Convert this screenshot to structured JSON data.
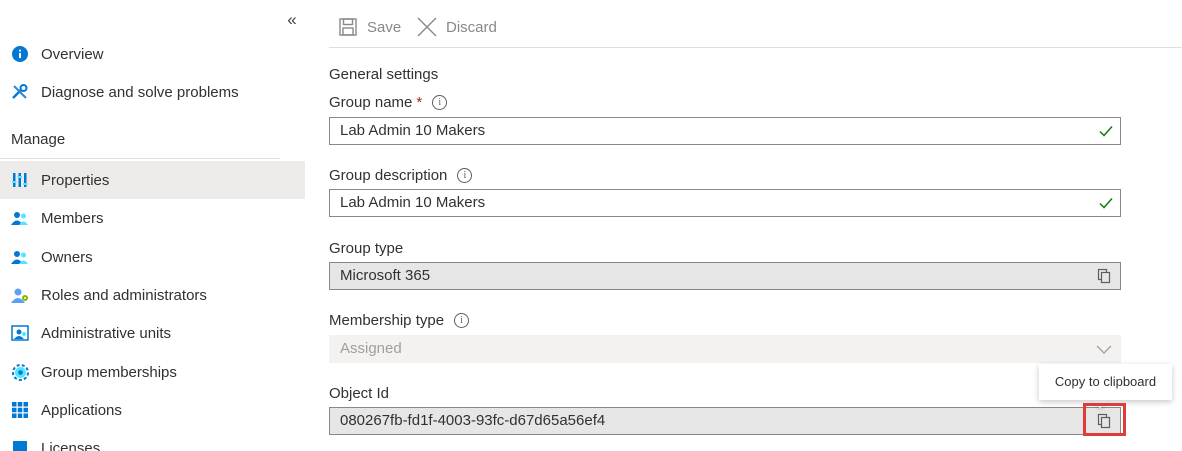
{
  "sidebar": {
    "collapse_glyph": "«",
    "top_items": [
      {
        "label": "Overview",
        "icon": "info-icon"
      },
      {
        "label": "Diagnose and solve problems",
        "icon": "wrench-icon"
      }
    ],
    "section_title": "Manage",
    "items": [
      {
        "label": "Properties",
        "icon": "properties-icon",
        "active": true
      },
      {
        "label": "Members",
        "icon": "members-icon"
      },
      {
        "label": "Owners",
        "icon": "owners-icon"
      },
      {
        "label": "Roles and administrators",
        "icon": "roles-icon"
      },
      {
        "label": "Administrative units",
        "icon": "admin-units-icon"
      },
      {
        "label": "Group memberships",
        "icon": "gear-icon"
      },
      {
        "label": "Applications",
        "icon": "grid-icon"
      },
      {
        "label": "Licenses",
        "icon": "license-icon"
      }
    ]
  },
  "toolbar": {
    "save_label": "Save",
    "discard_label": "Discard"
  },
  "form": {
    "section_title": "General settings",
    "group_name": {
      "label": "Group name",
      "required_mark": "*",
      "value": "Lab Admin 10 Makers"
    },
    "group_description": {
      "label": "Group description",
      "value": "Lab Admin 10 Makers"
    },
    "group_type": {
      "label": "Group type",
      "value": "Microsoft 365"
    },
    "membership_type": {
      "label": "Membership type",
      "value": "Assigned"
    },
    "object_id": {
      "label": "Object Id",
      "value": "080267fb-fd1f-4003-93fc-d67d65a56ef4"
    }
  },
  "tooltip": {
    "text": "Copy to clipboard"
  },
  "colors": {
    "accent": "#0078d4",
    "valid_check": "#107c10",
    "highlight": "#e03b3b",
    "active_row": "#edebe9"
  }
}
